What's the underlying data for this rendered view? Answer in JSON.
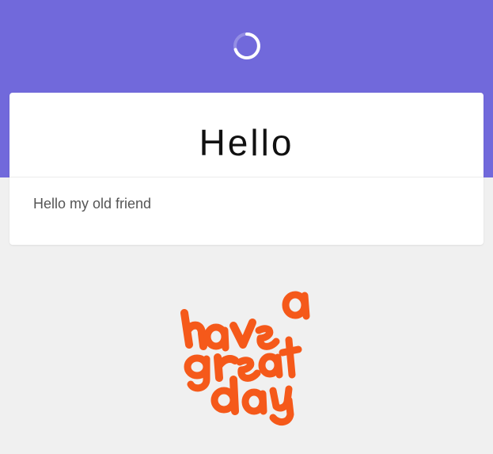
{
  "header": {
    "background_color": "#7169db",
    "spinner_icon": "loading-spinner-icon"
  },
  "card": {
    "title": "Hello",
    "message": "Hello my old friend"
  },
  "sticker": {
    "icon": "have-a-great-day-sticker",
    "text": "have a great day",
    "color": "#f5591a"
  }
}
